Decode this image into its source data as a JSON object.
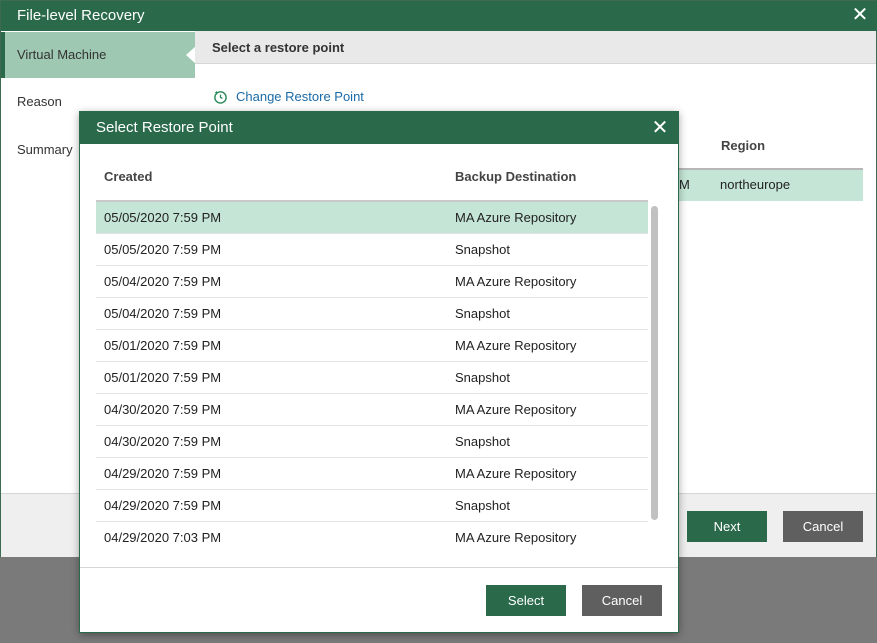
{
  "window": {
    "title": "File-level Recovery",
    "close_glyph": "✕"
  },
  "nav": {
    "items": [
      {
        "label": "Virtual Machine",
        "active": true
      },
      {
        "label": "Reason",
        "active": false
      },
      {
        "label": "Summary",
        "active": false
      }
    ]
  },
  "content": {
    "header_title": "Select a restore point",
    "change_restore_point_label": "Change Restore Point",
    "change_restore_point_icon": "restore-clock-icon",
    "background_table": {
      "col_partial_fragment": "M",
      "col_region_header": "Region",
      "region_value": "northeurope"
    }
  },
  "footer": {
    "next_label": "Next",
    "cancel_label": "Cancel"
  },
  "dialog": {
    "title": "Select Restore Point",
    "close_glyph": "✕",
    "columns": [
      "Created",
      "Backup Destination"
    ],
    "rows": [
      {
        "created": "05/05/2020 7:59 PM",
        "destination": "MA Azure Repository",
        "selected": true
      },
      {
        "created": "05/05/2020 7:59 PM",
        "destination": "Snapshot",
        "selected": false
      },
      {
        "created": "05/04/2020 7:59 PM",
        "destination": "MA Azure Repository",
        "selected": false
      },
      {
        "created": "05/04/2020 7:59 PM",
        "destination": "Snapshot",
        "selected": false
      },
      {
        "created": "05/01/2020 7:59 PM",
        "destination": "MA Azure Repository",
        "selected": false
      },
      {
        "created": "05/01/2020 7:59 PM",
        "destination": "Snapshot",
        "selected": false
      },
      {
        "created": "04/30/2020 7:59 PM",
        "destination": "MA Azure Repository",
        "selected": false
      },
      {
        "created": "04/30/2020 7:59 PM",
        "destination": "Snapshot",
        "selected": false
      },
      {
        "created": "04/29/2020 7:59 PM",
        "destination": "MA Azure Repository",
        "selected": false
      },
      {
        "created": "04/29/2020 7:59 PM",
        "destination": "Snapshot",
        "selected": false
      },
      {
        "created": "04/29/2020 7:03 PM",
        "destination": "MA Azure Repository",
        "selected": false
      }
    ],
    "select_label": "Select",
    "cancel_label": "Cancel"
  },
  "colors": {
    "brand_green": "#2a6a4a",
    "selected_row": "#c5e6d6",
    "link_blue": "#1a6aa8",
    "secondary_button": "#5f5f5f"
  }
}
